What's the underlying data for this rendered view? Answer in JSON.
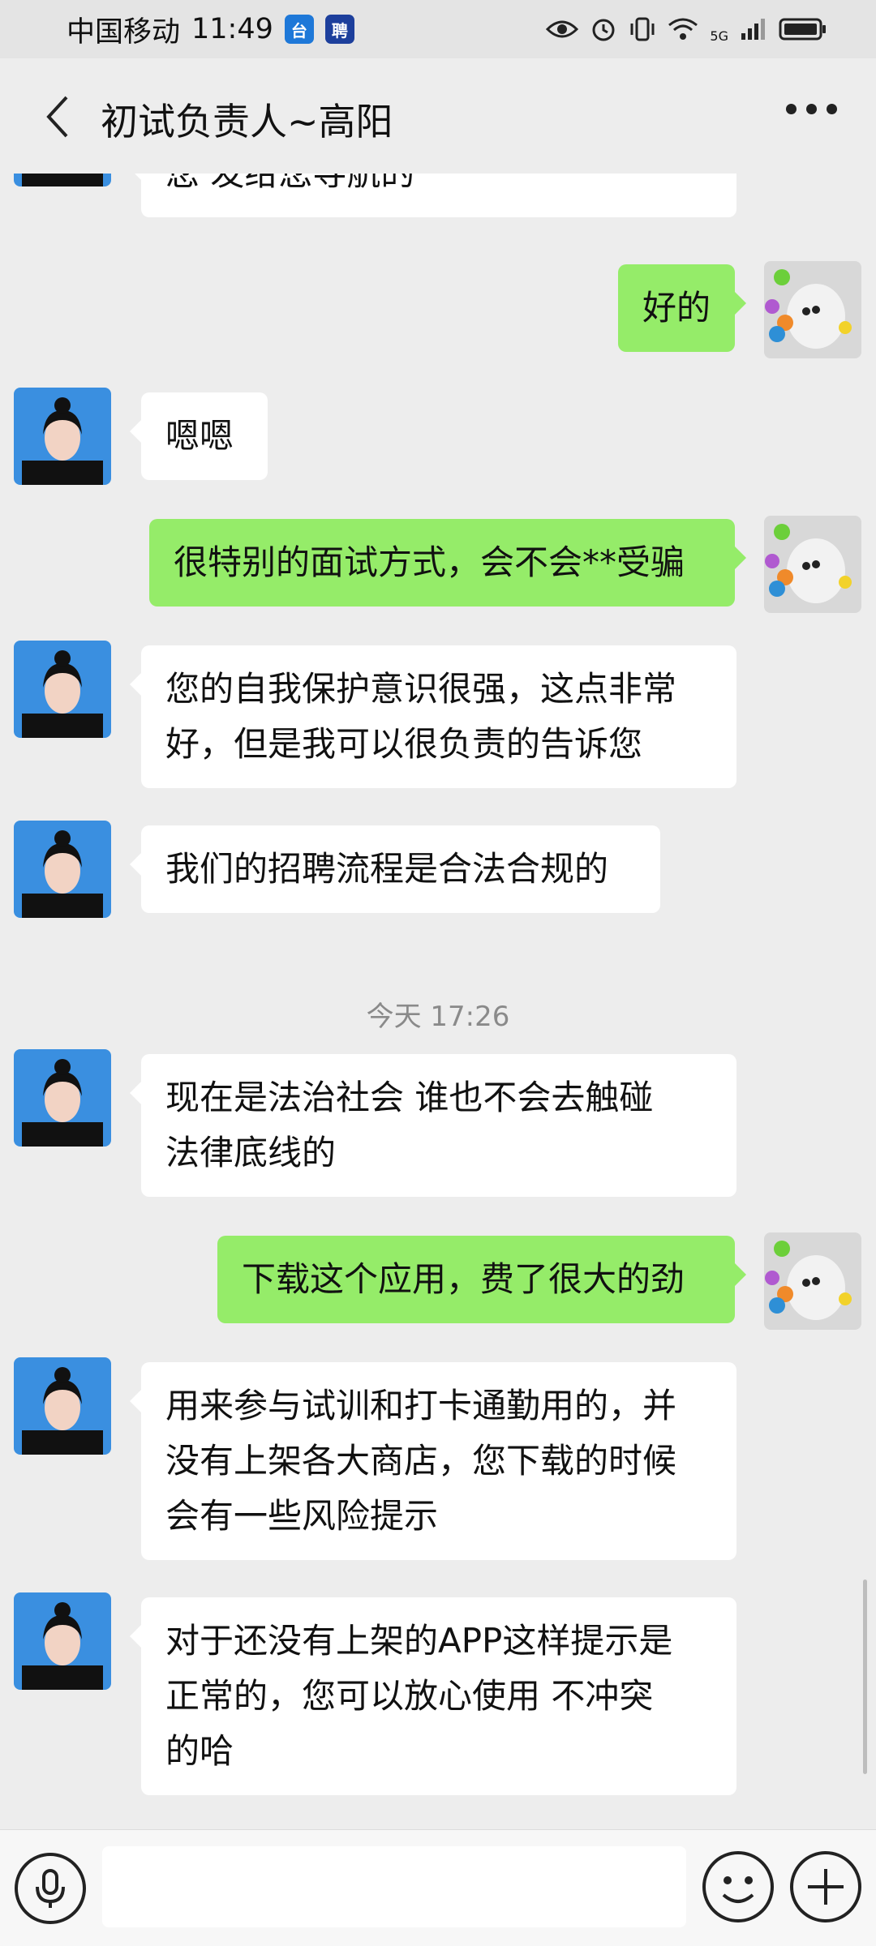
{
  "status_bar": {
    "carrier": "中国移动",
    "time": "11:49",
    "app_badge_1": "台",
    "app_badge_2": "聘",
    "network_label": "5G"
  },
  "header": {
    "title": "初试负责人~高阳"
  },
  "messages": [
    {
      "side": "left",
      "text": "您  发给您导航的"
    },
    {
      "side": "right",
      "text": "好的"
    },
    {
      "side": "left",
      "text": "嗯嗯"
    },
    {
      "side": "right",
      "text": "很特别的面试方式，会不会**受骗"
    },
    {
      "side": "left",
      "text": "您的自我保护意识很强，这点非常\n好，但是我可以很负责的告诉您"
    },
    {
      "side": "left",
      "text": "我们的招聘流程是合法合规的"
    },
    {
      "side": "left",
      "text": "现在是法治社会  谁也不会去触碰\n法律底线的"
    },
    {
      "side": "right",
      "text": "下载这个应用，费了很大的劲"
    },
    {
      "side": "left",
      "text": "用来参与试训和打卡通勤用的，并\n没有上架各大商店，您下载的时候\n会有一些风险提示"
    },
    {
      "side": "left",
      "text": "对于还没有上架的APP这样提示是\n正常的，您可以放心使用  不冲突\n的哈"
    }
  ],
  "timestamp": "今天 17:26",
  "colors": {
    "background": "#ededed",
    "sent_bubble": "#95ec69",
    "received_bubble": "#ffffff",
    "avatar_bg": "#3a8fe0"
  },
  "icons": {
    "back": "chevron-left-icon",
    "more": "more-dots-icon",
    "voice": "microphone-icon",
    "emoji": "smiley-icon",
    "plus": "plus-icon"
  }
}
